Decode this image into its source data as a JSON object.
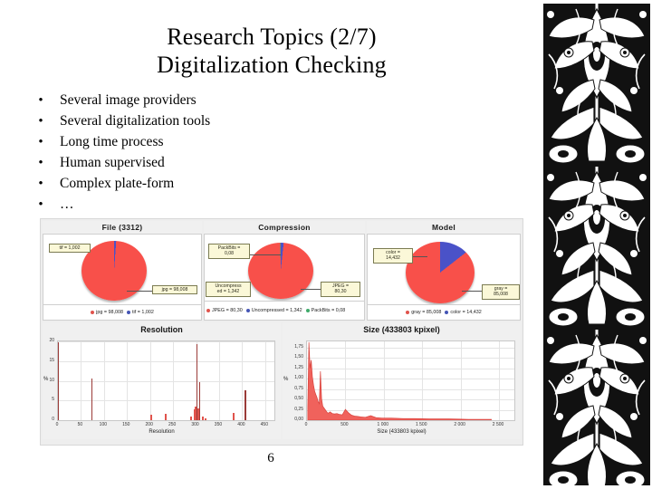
{
  "slide": {
    "title_line1": "Research Topics (2/7)",
    "title_line2": "Digitalization Checking",
    "page_number": "6",
    "bullet_marker": "•",
    "bullets": [
      "Several image providers",
      "Several digitalization tools",
      "Long time process",
      "Human supervised",
      "Complex plate-form",
      "…"
    ]
  },
  "screenshot": {
    "panels": [
      {
        "id": "file",
        "title": "File (3312)",
        "callouts": [
          {
            "text": "tif = 1,002"
          },
          {
            "text": "jpg = 98,008"
          }
        ],
        "legend": [
          {
            "label": "jpg = 98,008",
            "color": "#e0534c"
          },
          {
            "label": "tif = 1,002",
            "color": "#4455b5"
          }
        ],
        "slices": [
          {
            "name": "jpg",
            "value": 98.008,
            "color": "#f8504a"
          },
          {
            "name": "tif",
            "value": 1.002,
            "color": "#4a52c8"
          }
        ]
      },
      {
        "id": "compression",
        "title": "Compression",
        "callouts": [
          {
            "text": "PackBits =\n0,08"
          },
          {
            "text": "Uncompress\ned = 1,342"
          },
          {
            "text": "JPEG =\n80,30"
          }
        ],
        "legend": [
          {
            "label": "JPEG = 80,30",
            "color": "#e0534c"
          },
          {
            "label": "Uncompressed = 1,342",
            "color": "#4455b5"
          },
          {
            "label": "PackBits = 0,08",
            "color": "#3faa6a"
          }
        ],
        "slices": [
          {
            "name": "JPEG",
            "value": 80.3,
            "color": "#f8504a"
          },
          {
            "name": "Uncompressed",
            "value": 1.342,
            "color": "#4a52c8"
          },
          {
            "name": "PackBits",
            "value": 0.08,
            "color": "#3faa6a"
          }
        ]
      },
      {
        "id": "model",
        "title": "Model",
        "callouts": [
          {
            "text": "color =\n14,432"
          },
          {
            "text": "gray =\n85,008"
          }
        ],
        "legend": [
          {
            "label": "gray = 85,008",
            "color": "#e0534c"
          },
          {
            "label": "color = 14,432",
            "color": "#4455b5"
          }
        ],
        "slices": [
          {
            "name": "gray",
            "value": 85.008,
            "color": "#f8504a"
          },
          {
            "name": "color",
            "value": 14.432,
            "color": "#4a52c8"
          }
        ]
      }
    ]
  },
  "chart_data": [
    {
      "type": "bar",
      "title": "Resolution",
      "xlabel": "Resolution",
      "ylabel": "%",
      "xlim": [
        0,
        470
      ],
      "ylim": [
        0,
        20
      ],
      "xticks": [
        "0",
        "50",
        "100",
        "150",
        "200",
        "250",
        "300",
        "350",
        "400",
        "450"
      ],
      "xtick_values": [
        0,
        50,
        100,
        150,
        200,
        250,
        300,
        350,
        400,
        450
      ],
      "yticks": [
        "0",
        "5",
        "10",
        "15",
        "20"
      ],
      "ytick_values": [
        0,
        5,
        10,
        15,
        20
      ],
      "grid": true,
      "x": [
        0,
        72,
        200,
        232,
        288,
        294,
        297,
        300,
        303,
        306,
        312,
        318,
        380,
        406
      ],
      "values": [
        19.8,
        10.6,
        1.3,
        1.5,
        0.9,
        2.8,
        3.4,
        19.4,
        3.0,
        9.7,
        1.0,
        0.5,
        1.8,
        7.6
      ]
    },
    {
      "type": "area",
      "title": "Size (433803 kpixel)",
      "xlabel": "Size (433803 kpixel)",
      "ylabel": "%",
      "xlim": [
        0,
        2700
      ],
      "ylim": [
        0,
        1.9
      ],
      "xticks": [
        "0",
        "500",
        "1 000",
        "1 500",
        "2 000",
        "2 500"
      ],
      "xtick_values": [
        0,
        500,
        1000,
        1500,
        2000,
        2500
      ],
      "yticks": [
        "0,00",
        "0,25",
        "0,50",
        "0,75",
        "1,00",
        "1,25",
        "1,50",
        "1,75"
      ],
      "ytick_values": [
        0,
        0.25,
        0.5,
        0.75,
        1.0,
        1.25,
        1.5,
        1.75
      ],
      "grid": true,
      "x": [
        10,
        25,
        40,
        55,
        70,
        85,
        100,
        115,
        130,
        145,
        160,
        175,
        190,
        205,
        220,
        235,
        250,
        265,
        280,
        300,
        330,
        360,
        390,
        420,
        460,
        500,
        540,
        580,
        620,
        660,
        700,
        760,
        830,
        900,
        980,
        1100,
        1250,
        1400,
        1600,
        1850,
        2100,
        2400
      ],
      "values": [
        0.3,
        1.88,
        1.25,
        1.45,
        1.05,
        0.85,
        0.7,
        0.62,
        0.55,
        0.45,
        0.4,
        1.18,
        0.52,
        0.34,
        0.3,
        0.26,
        0.22,
        0.18,
        0.17,
        0.2,
        0.16,
        0.15,
        0.16,
        0.14,
        0.13,
        0.26,
        0.18,
        0.12,
        0.1,
        0.09,
        0.08,
        0.07,
        0.11,
        0.06,
        0.05,
        0.05,
        0.04,
        0.04,
        0.03,
        0.03,
        0.02,
        0.02
      ]
    }
  ]
}
